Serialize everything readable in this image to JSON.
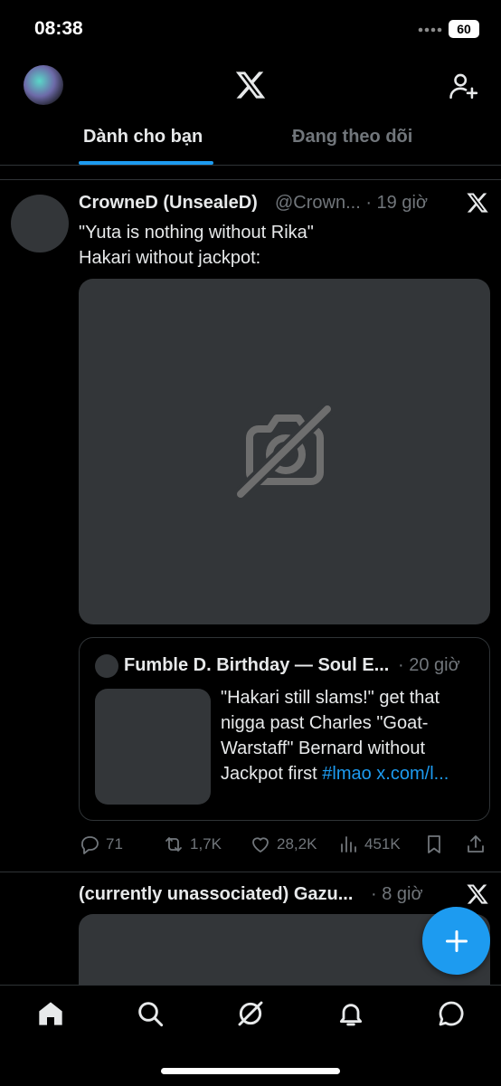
{
  "status_bar": {
    "time": "08:38",
    "battery": "60"
  },
  "header": {
    "tabs": [
      {
        "label": "Dành cho bạn",
        "active": true
      },
      {
        "label": "Đang theo dõi",
        "active": false
      }
    ]
  },
  "feed": {
    "posts": [
      {
        "name": "CrowneD (UnsealeD)",
        "handle_time": "@Crown... · 19 giờ",
        "text_line1": "\"Yuta is nothing without Rika\"",
        "text_line2": "Hakari without jackpot:",
        "quote": {
          "name": "Fumble D. Birthday — Soul E...",
          "time": "· 20 giờ",
          "text": "\"Hakari still slams!\" get that nigga past Charles \"Goat-Warstaff\" Bernard without Jackpot first ",
          "hashtag": "#lmao",
          "link": " x.com/l..."
        },
        "stats": {
          "replies": "71",
          "reposts": "1,7K",
          "likes": "28,2K",
          "views": "451K"
        }
      },
      {
        "name": "(currently unassociated) Gazu...",
        "time": "· 8 giờ"
      }
    ]
  },
  "colors": {
    "accent": "#1d9bf0",
    "background": "#000000",
    "muted": "#71767b",
    "placeholder": "#333639"
  },
  "icons": [
    "x-logo-icon",
    "add-user-icon",
    "image-off-icon",
    "reply-icon",
    "repost-icon",
    "like-icon",
    "views-icon",
    "bookmark-icon",
    "share-icon",
    "plus-icon",
    "home-icon",
    "search-icon",
    "grok-icon",
    "bell-icon",
    "messages-icon"
  ]
}
